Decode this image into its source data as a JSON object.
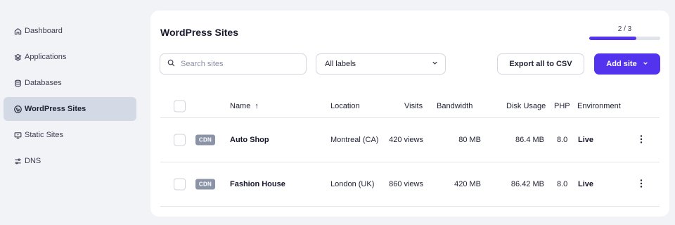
{
  "sidebar": {
    "items": [
      {
        "label": "Dashboard",
        "icon": "home-icon",
        "active": false
      },
      {
        "label": "Applications",
        "icon": "layers-icon",
        "active": false
      },
      {
        "label": "Databases",
        "icon": "database-icon",
        "active": false
      },
      {
        "label": "WordPress Sites",
        "icon": "wordpress-icon",
        "active": true
      },
      {
        "label": "Static Sites",
        "icon": "monitor-icon",
        "active": false
      },
      {
        "label": "DNS",
        "icon": "dns-icon",
        "active": false
      }
    ]
  },
  "main": {
    "title": "WordPress Sites",
    "usage": {
      "label": "2 / 3",
      "used": 2,
      "total": 3
    },
    "search": {
      "placeholder": "Search sites",
      "value": ""
    },
    "label_filter": {
      "selected": "All labels"
    },
    "export_label": "Export all to CSV",
    "add_site_label": "Add site",
    "accent": "#5333ed"
  },
  "table": {
    "headers": {
      "name": "Name",
      "location": "Location",
      "visits": "Visits",
      "bandwidth": "Bandwidth",
      "disk_usage": "Disk Usage",
      "php": "PHP",
      "environment": "Environment"
    },
    "sort_indicator": "↑",
    "rows": [
      {
        "badge": "CDN",
        "name": "Auto Shop",
        "location": "Montreal (CA)",
        "visits": "420 views",
        "bandwidth": "80 MB",
        "disk_usage": "86.4 MB",
        "php": "8.0",
        "environment": "Live"
      },
      {
        "badge": "CDN",
        "name": "Fashion House",
        "location": "London (UK)",
        "visits": "860 views",
        "bandwidth": "420 MB",
        "disk_usage": "86.42 MB",
        "php": "8.0",
        "environment": "Live"
      }
    ]
  }
}
